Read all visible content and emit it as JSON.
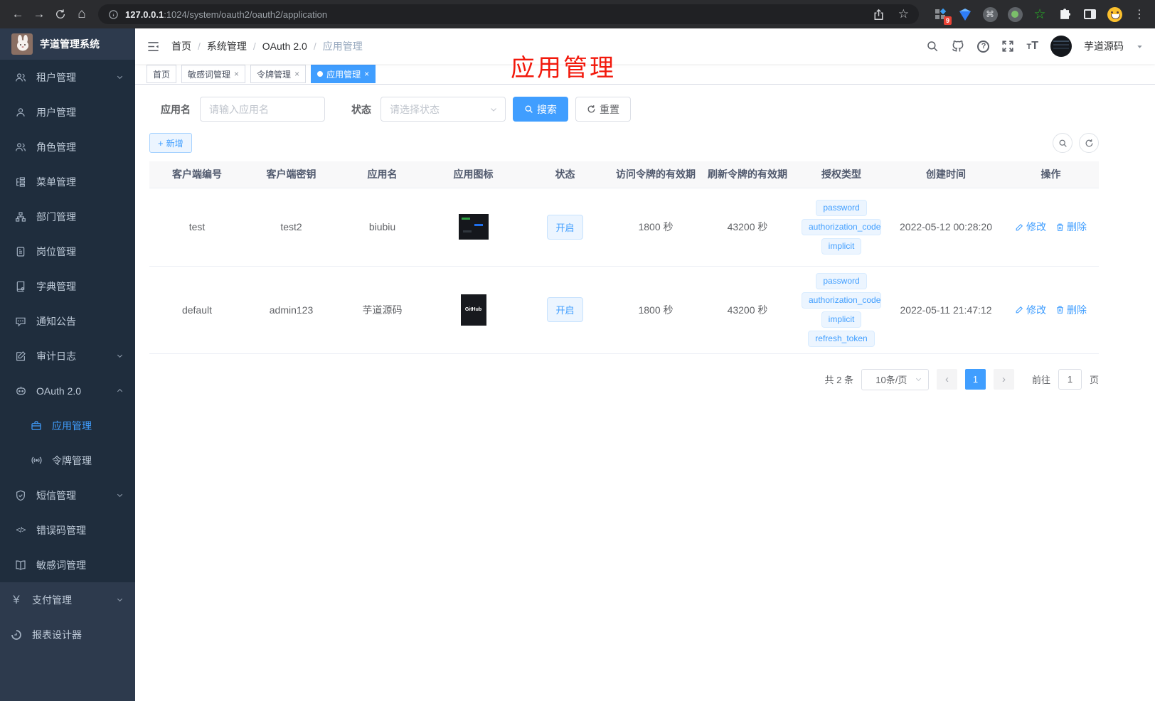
{
  "browser": {
    "url_host": "127.0.0.1",
    "url_rest": ":1024/system/oauth2/oauth2/application",
    "extension_badge": "9"
  },
  "icons": {
    "close": "×",
    "plus": "+",
    "slash": "/",
    "back": "←",
    "forward": "→",
    "home": "⌂",
    "star": "☆",
    "menu_dots": "⋮",
    "prev": "‹",
    "next": "›",
    "yen": "¥",
    "code": "</>",
    "command": "⌘",
    "question": "?",
    "green_star": "☆",
    "t_small": "T",
    "t_large": "T"
  },
  "sidebar": {
    "title": "芋道管理系统",
    "items": [
      {
        "label": "租户管理"
      },
      {
        "label": "用户管理"
      },
      {
        "label": "角色管理"
      },
      {
        "label": "菜单管理"
      },
      {
        "label": "部门管理"
      },
      {
        "label": "岗位管理"
      },
      {
        "label": "字典管理"
      },
      {
        "label": "通知公告"
      },
      {
        "label": "审计日志"
      },
      {
        "label": "OAuth 2.0"
      },
      {
        "label": "应用管理"
      },
      {
        "label": "令牌管理"
      },
      {
        "label": "短信管理"
      },
      {
        "label": "错误码管理"
      },
      {
        "label": "敏感词管理"
      },
      {
        "label": "支付管理"
      },
      {
        "label": "报表设计器"
      }
    ]
  },
  "header": {
    "breadcrumb": [
      "首页",
      "系统管理",
      "OAuth 2.0",
      "应用管理"
    ],
    "username": "芋道源码"
  },
  "annotation": {
    "text": "应用管理"
  },
  "tabs": [
    {
      "label": "首页"
    },
    {
      "label": "敏感词管理"
    },
    {
      "label": "令牌管理"
    },
    {
      "label": "应用管理"
    }
  ],
  "filters": {
    "app_name_label": "应用名",
    "app_name_placeholder": "请输入应用名",
    "status_label": "状态",
    "status_placeholder": "请选择状态",
    "search_label": "搜索",
    "reset_label": "重置",
    "add_label": "新增"
  },
  "table": {
    "headers": [
      "客户端编号",
      "客户端密钥",
      "应用名",
      "应用图标",
      "状态",
      "访问令牌的有效期",
      "刷新令牌的有效期",
      "授权类型",
      "创建时间",
      "操作"
    ],
    "rows": [
      {
        "client_id": "test",
        "client_secret": "test2",
        "app_name": "biubiu",
        "status": "开启",
        "access_validity": "1800 秒",
        "refresh_validity": "43200 秒",
        "grants": [
          "password",
          "authorization_code",
          "implicit"
        ],
        "created": "2022-05-12 00:28:20"
      },
      {
        "client_id": "default",
        "client_secret": "admin123",
        "app_name": "芋道源码",
        "status": "开启",
        "access_validity": "1800 秒",
        "refresh_validity": "43200 秒",
        "grants": [
          "password",
          "authorization_code",
          "implicit",
          "refresh_token"
        ],
        "created": "2022-05-11 21:47:12",
        "icon_label": "GitHub"
      }
    ],
    "edit_label": "修改",
    "delete_label": "删除"
  },
  "pagination": {
    "total": "共 2 条",
    "page_size": "10条/页",
    "current_page": "1",
    "goto_label": "前往",
    "goto_value": "1",
    "page_unit": "页"
  }
}
